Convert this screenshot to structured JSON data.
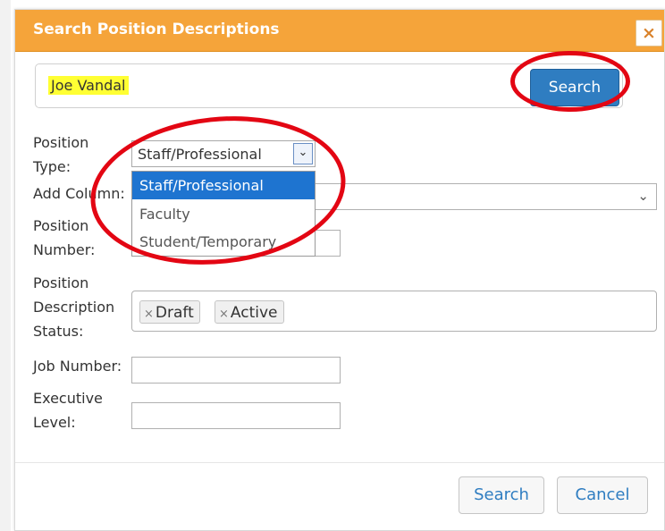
{
  "dialog": {
    "title": "Search Position Descriptions",
    "close_label": "×",
    "accent_color": "#f5a43a"
  },
  "search": {
    "value": "Joe Vandal",
    "button_label": "Search",
    "highlight_color": "#ffff33"
  },
  "form": {
    "position_type_label_line1": "Position",
    "position_type_label_line2": "Type:",
    "position_type_selected": "Staff/Professional",
    "position_type_options": [
      "Staff/Professional",
      "Faculty",
      "Student/Temporary"
    ],
    "add_column_label": "Add Column:",
    "position_number_label_line1": "Position",
    "position_number_label_line2": "Number:",
    "status_label_line1": "Position",
    "status_label_line2": "Description",
    "status_label_line3": "Status:",
    "status_tags": [
      "Draft",
      "Active"
    ],
    "job_number_label": "Job Number:",
    "executive_level_label_line1": "Executive",
    "executive_level_label_line2": "Level:"
  },
  "footer": {
    "search_label": "Search",
    "cancel_label": "Cancel"
  },
  "annotation": {
    "circle_color": "#e30613"
  }
}
